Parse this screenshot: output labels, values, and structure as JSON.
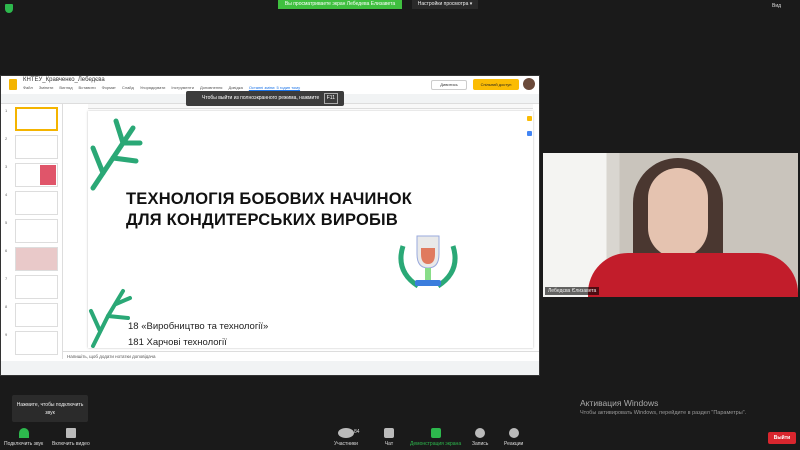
{
  "zoom_top": {
    "banner": "Вы просматриваете экран Лебедева Елизавета",
    "view_options": "Настройки просмотра ▾",
    "view": "Вид"
  },
  "slides_app": {
    "doc_title": "КНТЕУ_Кравченко_Лебедєва",
    "menu": [
      "Файл",
      "Змінити",
      "Вигляд",
      "Вставити",
      "Формат",
      "Слайд",
      "Упорядкувати",
      "Інструменти",
      "Доповнення",
      "Довідка",
      "Останні зміни: 5 годин тому"
    ],
    "present_button": "Дивитись",
    "share_button": "Спільний доступ",
    "fullscreen_tip": "Чтобы выйти из полноэкранного режима, нажмите",
    "fullscreen_key": "F11",
    "slide_numbers": [
      "1",
      "2",
      "3",
      "4",
      "5",
      "6",
      "7",
      "8",
      "9"
    ],
    "slide": {
      "title_line1": "ТЕХНОЛОГІЯ БОБОВИХ НАЧИНОК",
      "title_line2": "ДЛЯ КОНДИТЕРСЬКИХ ВИРОБІВ",
      "subtitle1": "18 «Виробництво та технології»",
      "subtitle2": "181 Харчові технології"
    },
    "notes_placeholder": "Напишіть, щоб додати нотатки доповідача"
  },
  "video": {
    "participant_name": "Лебедєва Єлизавета"
  },
  "audio_tip": "Нажмите, чтобы подключить звук",
  "windows_activation": {
    "title": "Активация Windows",
    "text": "Чтобы активировать Windows, перейдите в раздел \"Параметры\"."
  },
  "toolbar": {
    "audio": "Подключить звук",
    "video": "Включить видео",
    "participants": "Участники",
    "participants_count": "84",
    "chat": "Чат",
    "share_screen": "Демонстрация экрана",
    "record": "Запись",
    "reactions": "Реакции",
    "leave": "Выйти"
  }
}
